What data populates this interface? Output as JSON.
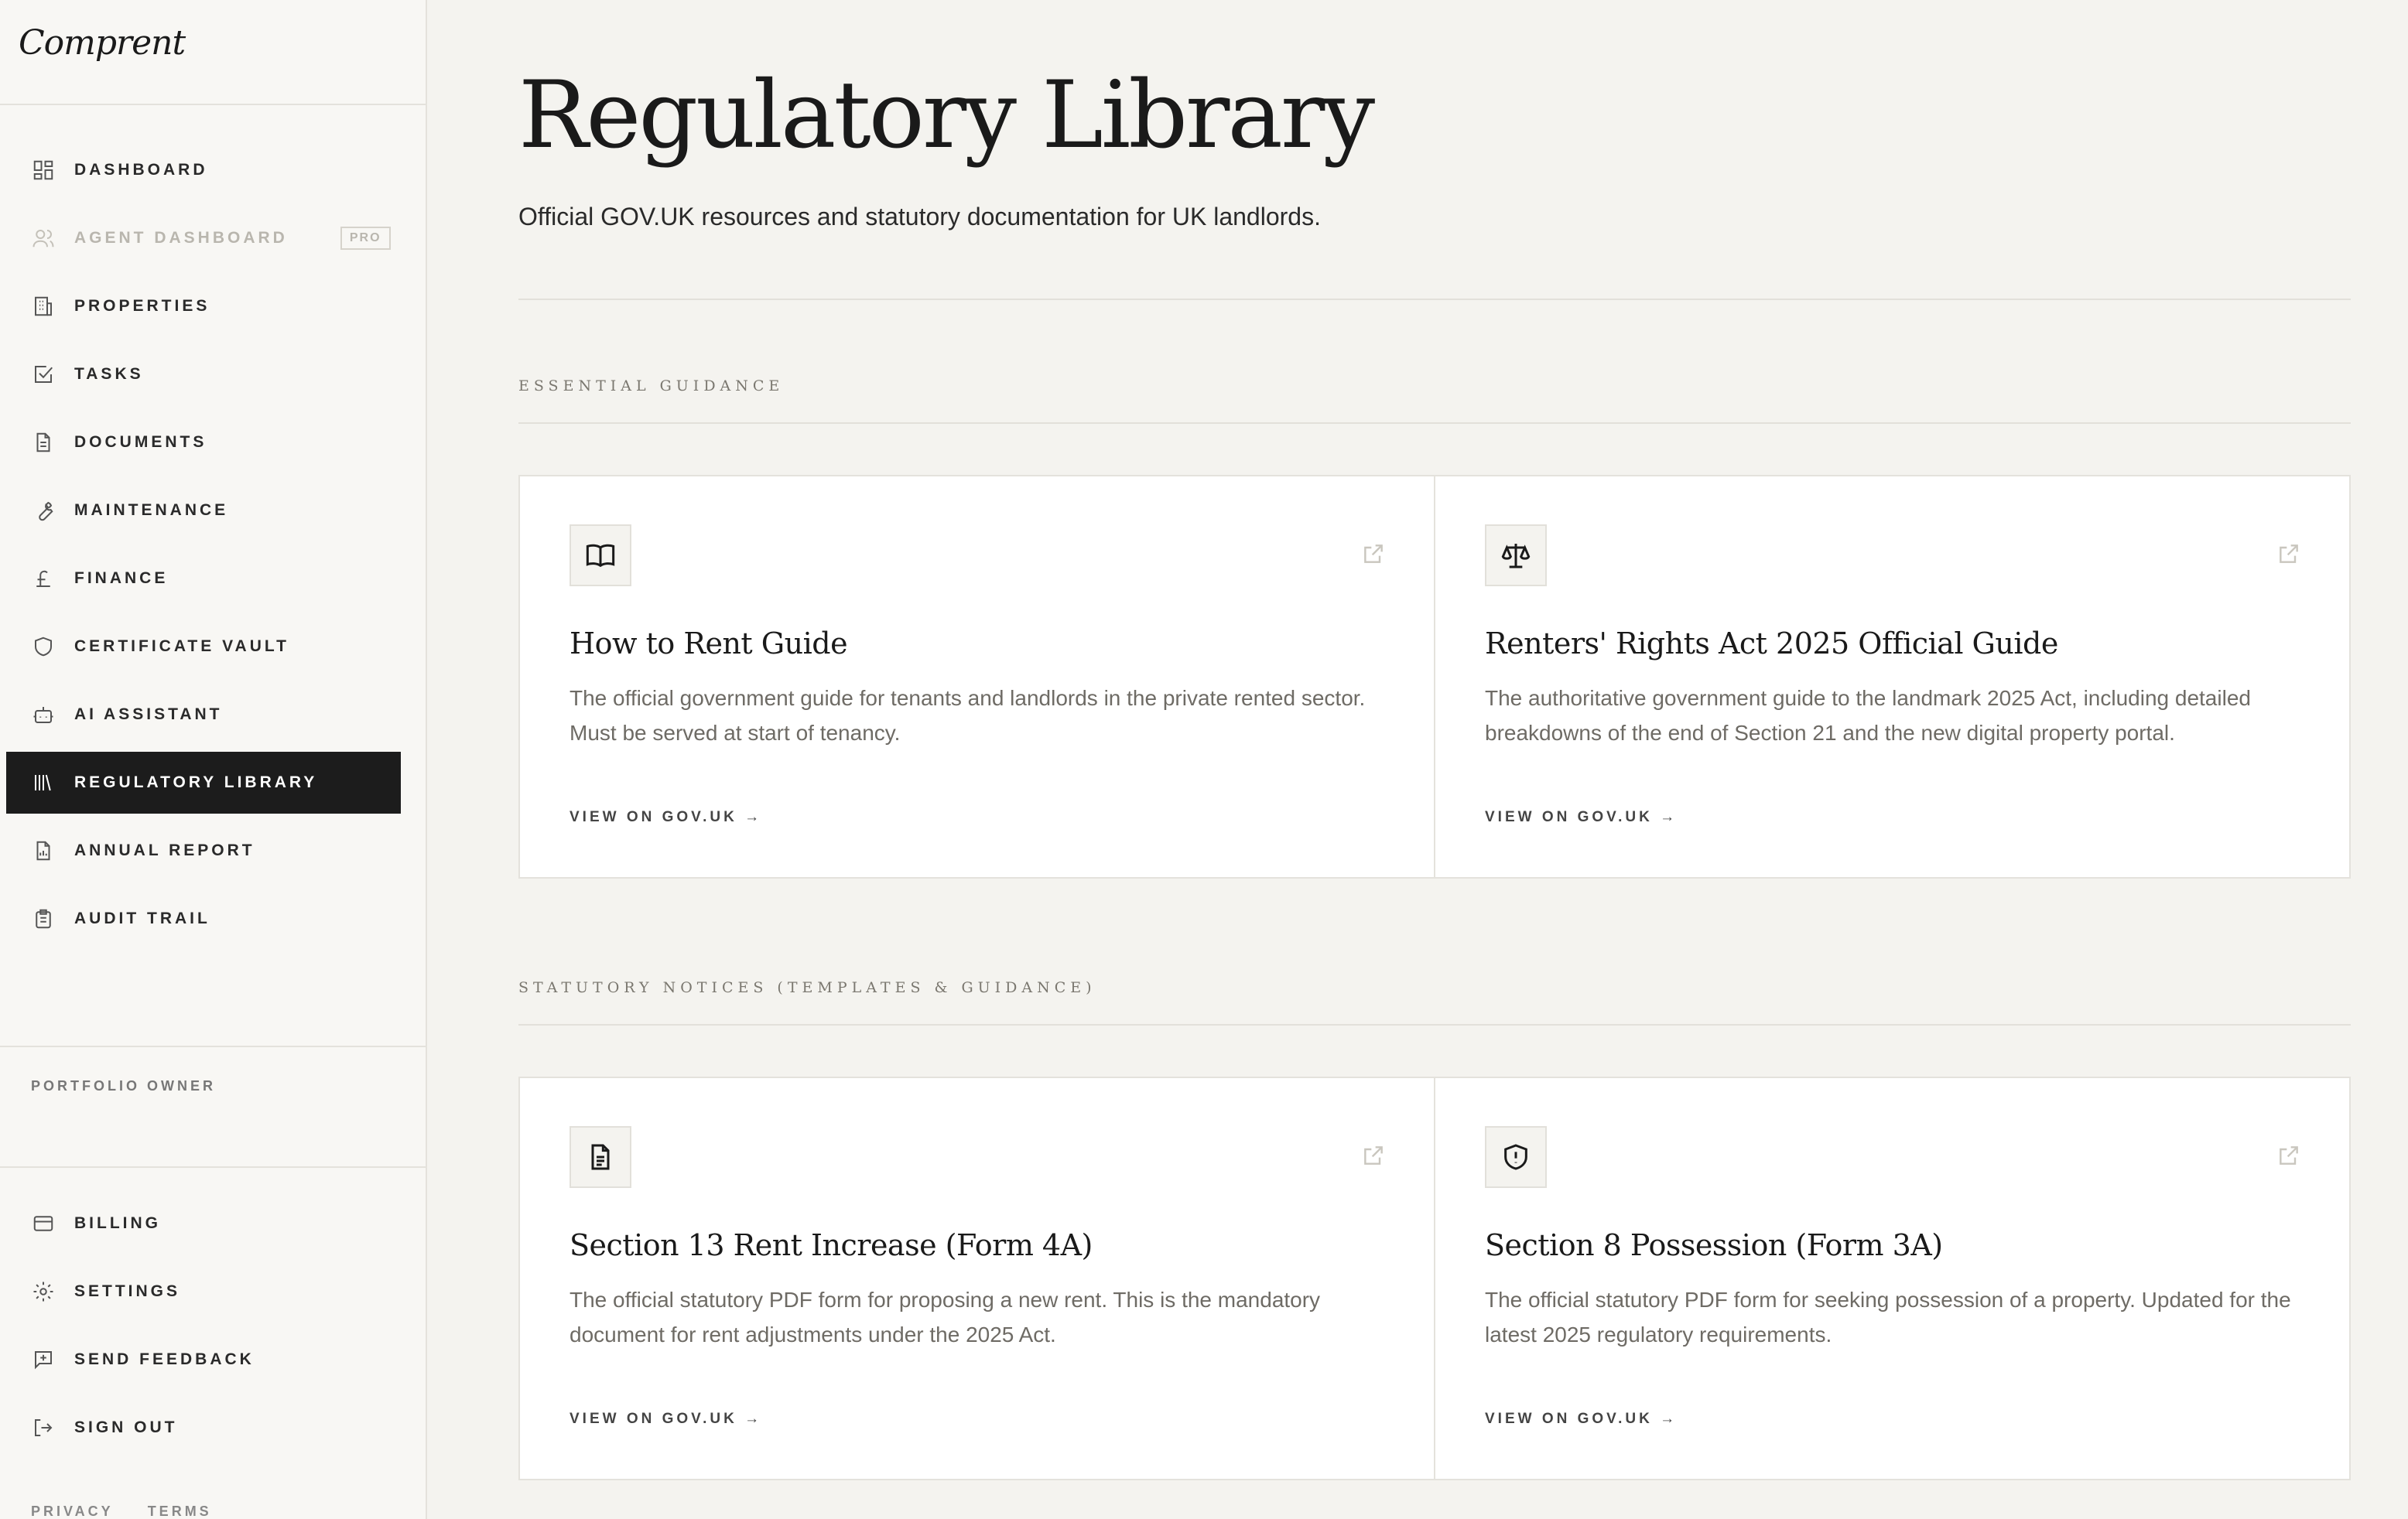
{
  "app": {
    "logo": "Comprent"
  },
  "sidebar": {
    "items": [
      {
        "label": "DASHBOARD",
        "icon": "dashboard-icon"
      },
      {
        "label": "AGENT DASHBOARD",
        "icon": "users-icon",
        "badge": "PRO",
        "disabled": true
      },
      {
        "label": "PROPERTIES",
        "icon": "building-icon"
      },
      {
        "label": "TASKS",
        "icon": "checkbox-icon"
      },
      {
        "label": "DOCUMENTS",
        "icon": "document-icon"
      },
      {
        "label": "MAINTENANCE",
        "icon": "wrench-icon"
      },
      {
        "label": "FINANCE",
        "icon": "pound-icon"
      },
      {
        "label": "CERTIFICATE VAULT",
        "icon": "shield-icon"
      },
      {
        "label": "AI ASSISTANT",
        "icon": "robot-icon"
      },
      {
        "label": "REGULATORY LIBRARY",
        "icon": "library-icon",
        "active": true
      },
      {
        "label": "ANNUAL REPORT",
        "icon": "report-icon"
      },
      {
        "label": "AUDIT TRAIL",
        "icon": "clipboard-icon"
      }
    ],
    "owner_label": "PORTFOLIO OWNER",
    "bottom_items": [
      {
        "label": "BILLING",
        "icon": "credit-card-icon"
      },
      {
        "label": "SETTINGS",
        "icon": "gear-icon"
      },
      {
        "label": "SEND FEEDBACK",
        "icon": "feedback-icon"
      },
      {
        "label": "SIGN OUT",
        "icon": "sign-out-icon"
      }
    ],
    "footer": {
      "privacy": "PRIVACY",
      "terms": "TERMS"
    }
  },
  "main": {
    "title": "Regulatory Library",
    "subtitle": "Official GOV.UK resources and statutory documentation for UK landlords.",
    "sections": [
      {
        "label": "ESSENTIAL GUIDANCE",
        "cards": [
          {
            "icon": "book-icon",
            "title": "How to Rent Guide",
            "description": "The official government guide for tenants and landlords in the private rented sector. Must be served at start of tenancy.",
            "link": "VIEW ON GOV.UK →"
          },
          {
            "icon": "scales-icon",
            "title": "Renters' Rights Act 2025 Official Guide",
            "description": "The authoritative government guide to the landmark 2025 Act, including detailed breakdowns of the end of Section 21 and the new digital property portal.",
            "link": "VIEW ON GOV.UK →"
          }
        ]
      },
      {
        "label": "STATUTORY NOTICES (TEMPLATES & GUIDANCE)",
        "cards": [
          {
            "icon": "file-text-icon",
            "title": "Section 13 Rent Increase (Form 4A)",
            "description": "The official statutory PDF form for proposing a new rent. This is the mandatory document for rent adjustments under the 2025 Act.",
            "link": "VIEW ON GOV.UK →"
          },
          {
            "icon": "shield-alert-icon",
            "title": "Section 8 Possession (Form 3A)",
            "description": "The official statutory PDF form for seeking possession of a property. Updated for the latest 2025 regulatory requirements.",
            "link": "VIEW ON GOV.UK →"
          }
        ]
      }
    ]
  }
}
